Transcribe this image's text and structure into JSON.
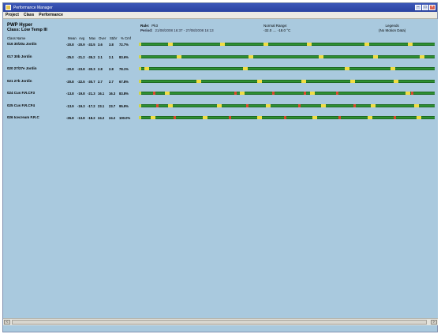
{
  "window": {
    "title": "Performance Manager"
  },
  "menu": [
    {
      "id": "project",
      "label": "Project"
    },
    {
      "id": "class",
      "label": "Class"
    },
    {
      "id": "performance",
      "label": "Performance"
    }
  ],
  "header": {
    "project_name": "PWP Hyper",
    "class_name": "Class: Low Temp III",
    "rule_label": "Rule:",
    "rule_value": "Pk3",
    "period_label": "Period:",
    "period_value": "21/08/2008 16:37 - 27/08/2008 16:13",
    "range_title": "Normal Range:",
    "range_value": "-32.0 .... -18.0 °C",
    "legend_title": "Legends",
    "legend_value": "(No Motion Data)"
  },
  "columns": [
    {
      "id": "name",
      "label": "Class Name"
    },
    {
      "id": "mean",
      "label": "Mean"
    },
    {
      "id": "avg",
      "label": "Avg"
    },
    {
      "id": "max",
      "label": "Max"
    },
    {
      "id": "over",
      "label": "Over"
    },
    {
      "id": "stdv",
      "label": "StdV"
    },
    {
      "id": "pct",
      "label": "% Cmf"
    }
  ],
  "rows": [
    {
      "name": "016 30/20a Jordin",
      "vals": [
        "-20.8",
        "-20.9",
        "-33.5",
        "3.6",
        "3.8",
        "72.7%"
      ],
      "marks": [
        0.1,
        0.28,
        0.43,
        0.58,
        0.78,
        0.93
      ],
      "red_marks": []
    },
    {
      "name": "017 30b Jordin",
      "vals": [
        "-25.0",
        "-21.2",
        "-35.2",
        "2.1",
        "2.1",
        "83.6%"
      ],
      "marks": [
        0.13,
        0.38,
        0.62,
        0.81,
        0.97
      ],
      "red_marks": []
    },
    {
      "name": "020 27/27e Jordin",
      "vals": [
        "-20.8",
        "-23.8",
        "-30.3",
        "2.8",
        "2.8",
        "78.1%"
      ],
      "marks": [
        0.02,
        0.36,
        0.71,
        0.87
      ],
      "red_marks": []
    },
    {
      "name": "021 27b Jordin",
      "vals": [
        "-20.8",
        "-22.5",
        "-30.7",
        "2.7",
        "2.7",
        "67.8%"
      ],
      "marks": [
        0.2,
        0.41,
        0.56,
        0.73,
        0.88
      ],
      "red_marks": []
    },
    {
      "name": "024 Cus F.R.CF3",
      "vals": [
        "-13.8",
        "-19.8",
        "-21.3",
        "16.1",
        "16.3",
        "83.8%"
      ],
      "marks": [
        0.09,
        0.35,
        0.59,
        0.92
      ],
      "red_marks": [
        0.05,
        0.33,
        0.46,
        0.57,
        0.68,
        0.94
      ]
    },
    {
      "name": "025 Cus F.R.CF4",
      "vals": [
        "-13.9",
        "-19.3",
        "-17.2",
        "23.1",
        "23.7",
        "95.9%"
      ],
      "marks": [
        0.1,
        0.27,
        0.44,
        0.63,
        0.8,
        0.95
      ],
      "red_marks": [
        0.06,
        0.37,
        0.55,
        0.74
      ]
    },
    {
      "name": "026 Icecream F.R.C",
      "vals": [
        "-26.8",
        "-13.8",
        "-18.2",
        "24.2",
        "24.2",
        "100.0%"
      ],
      "marks": [
        0.04,
        0.22,
        0.41,
        0.6,
        0.79,
        0.96
      ],
      "red_marks": [
        0.12,
        0.31,
        0.5,
        0.69,
        0.88
      ]
    }
  ],
  "colors": {
    "background": "#a9c9de",
    "track": "#2e8f32",
    "in_range_mark": "#f1dd43",
    "alarm_mark": "#d84a2a",
    "titlebar": "#2b43a0"
  },
  "icons": {
    "minimize": "minimize-icon",
    "maximize": "maximize-icon",
    "close": "close-icon",
    "scroll_left": "arrow-left-icon",
    "scroll_right": "arrow-right-icon"
  }
}
